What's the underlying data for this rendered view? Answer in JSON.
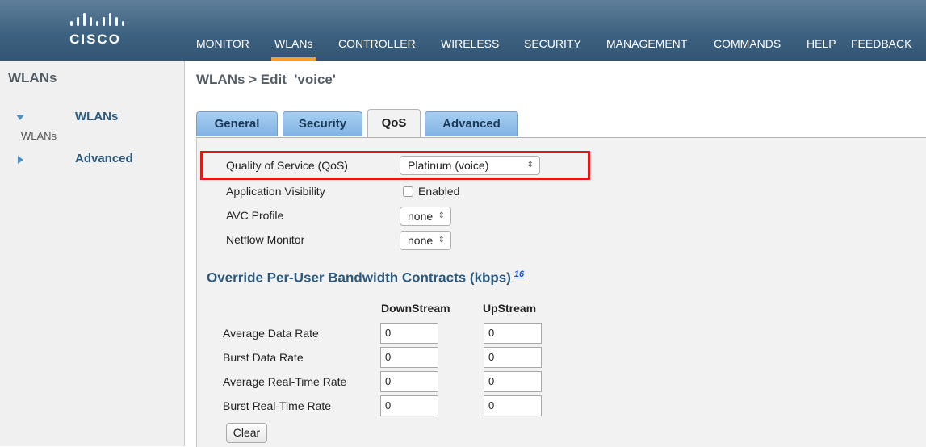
{
  "header": {
    "brand": "CISCO",
    "nav": [
      {
        "label": "MONITOR"
      },
      {
        "label": "WLANs"
      },
      {
        "label": "CONTROLLER"
      },
      {
        "label": "WIRELESS"
      },
      {
        "label": "SECURITY"
      },
      {
        "label": "MANAGEMENT"
      },
      {
        "label": "COMMANDS"
      },
      {
        "label": "HELP"
      },
      {
        "label": "FEEDBACK"
      }
    ],
    "active_nav": "WLANs"
  },
  "sidebar": {
    "title": "WLANs",
    "items": [
      {
        "label": "WLANs",
        "sub": "WLANs",
        "expanded": true,
        "icon": "triangle-down-icon"
      },
      {
        "label": "Advanced",
        "expanded": false,
        "icon": "triangle-right-icon"
      }
    ]
  },
  "page": {
    "title": "WLANs > Edit  'voice'"
  },
  "tabs": [
    {
      "label": "General"
    },
    {
      "label": "Security"
    },
    {
      "label": "QoS"
    },
    {
      "label": "Advanced"
    }
  ],
  "active_tab": "QoS",
  "qos": {
    "quality_of_service_label": "Quality of Service (QoS)",
    "quality_of_service_value": "Platinum (voice)",
    "app_visibility_label": "Application Visibility",
    "app_visibility_checkbox_label": "Enabled",
    "app_visibility_checked": false,
    "avc_profile_label": "AVC Profile",
    "avc_profile_value": "none",
    "netflow_monitor_label": "Netflow Monitor",
    "netflow_monitor_value": "none"
  },
  "bandwidth": {
    "title": "Override Per-User Bandwidth Contracts (kbps)",
    "footnote": "16",
    "col_downstream": "DownStream",
    "col_upstream": "UpStream",
    "rows": [
      {
        "label": "Average Data Rate",
        "downstream": "0",
        "upstream": "0"
      },
      {
        "label": "Burst Data Rate",
        "downstream": "0",
        "upstream": "0"
      },
      {
        "label": "Average Real-Time Rate",
        "downstream": "0",
        "upstream": "0"
      },
      {
        "label": "Burst Real-Time Rate",
        "downstream": "0",
        "upstream": "0"
      }
    ],
    "clear_label": "Clear"
  },
  "colors": {
    "header_bg": "#3e6281",
    "active_nav_underline": "#f0a032",
    "highlight_border": "#e01919",
    "section_title": "#2c5a7e",
    "tab_bg": "#7fb2e3"
  }
}
